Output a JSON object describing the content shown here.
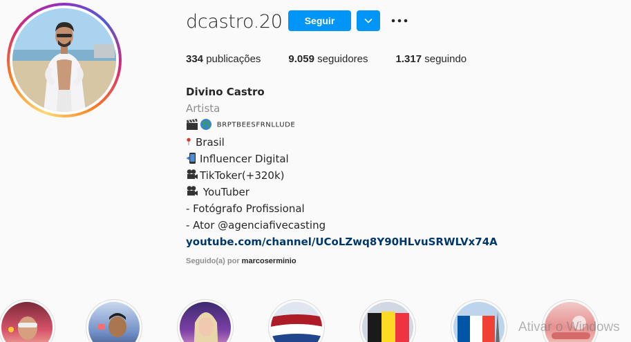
{
  "profile": {
    "username": "dcastro.20",
    "follow_label": "Seguir"
  },
  "stats": {
    "posts_count": "334",
    "posts_label": "publicações",
    "followers_count": "9.059",
    "followers_label": "seguidores",
    "following_count": "1.317",
    "following_label": "seguindo"
  },
  "bio": {
    "name": "Divino Castro",
    "category": "Artista",
    "line1": "BRPTBEESFRNLLUDE",
    "line2": "Brasil",
    "line3": "Influencer Digital",
    "line4": "TikToker(+320k)",
    "line5": "YouTuber",
    "line6": "- Fotógrafo Profissional",
    "line7": "- Ator @agenciafivecasting",
    "link": "youtube.com/channel/UCoLZwq8Y90HLvuSRWLVx74A"
  },
  "followed_by": {
    "prefix": "Seguido(a) por",
    "user": "marcoserminio"
  },
  "icons": {
    "clapper": "clapper-board-icon",
    "globe": "globe-icon",
    "pin": "round-pushpin-icon",
    "phone": "mobile-phone-icon",
    "camera1": "movie-camera-icon",
    "camera2": "movie-camera-icon",
    "dropdown": "chevron-down-icon",
    "more": "more-options-icon"
  },
  "highlights": [
    "highlight-1",
    "highlight-2",
    "highlight-3",
    "highlight-netherlands",
    "highlight-belgium",
    "highlight-france",
    "highlight-7"
  ],
  "watermark": "Ativar o Windows",
  "colors": {
    "accent": "#0095f6",
    "link": "#00376b",
    "muted": "#8e8e8e",
    "text": "#262626"
  }
}
